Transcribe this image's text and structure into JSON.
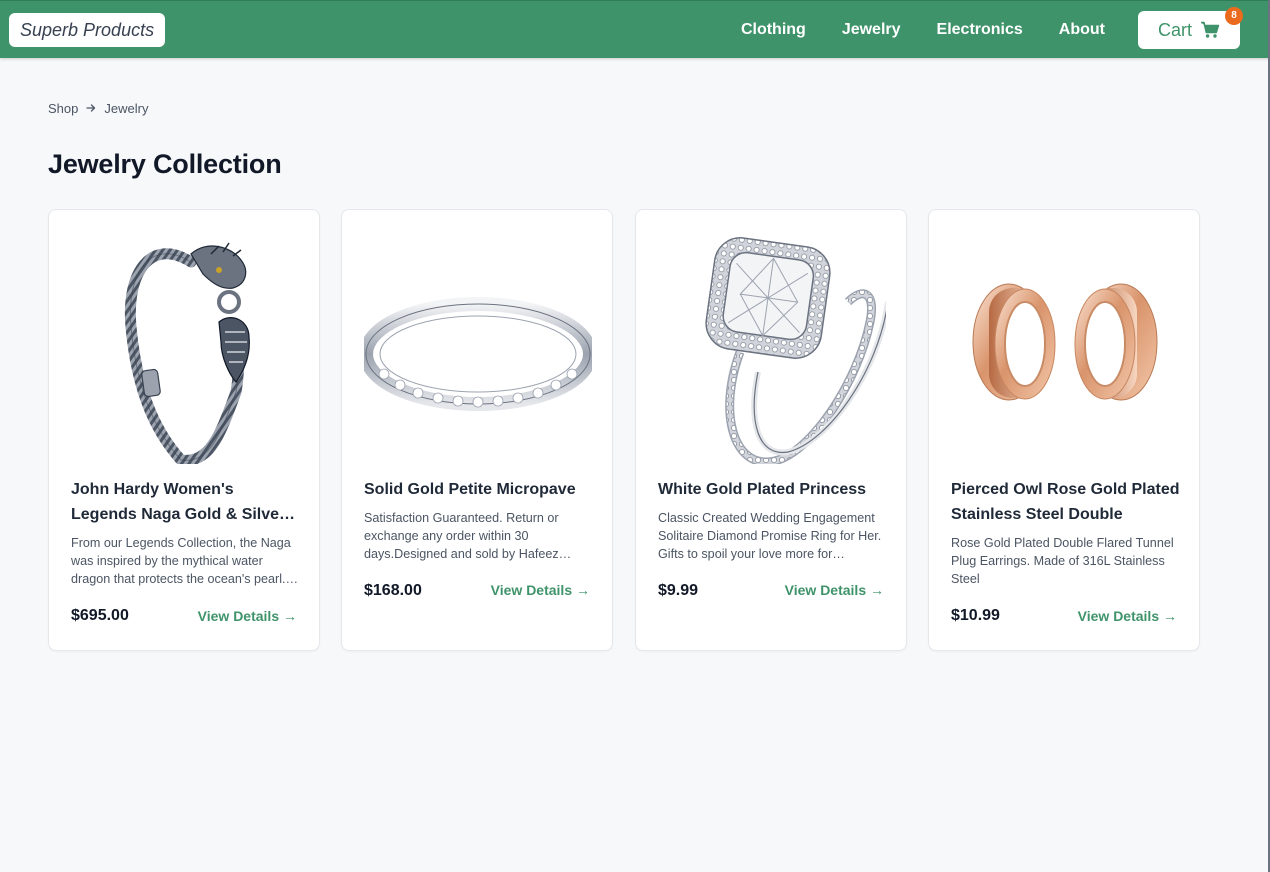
{
  "navbar": {
    "brand": "Superb Products",
    "links": [
      "Clothing",
      "Jewelry",
      "Electronics",
      "About"
    ],
    "cart_label": "Cart",
    "cart_count": "8",
    "cart_icon": "shopping-cart-icon"
  },
  "breadcrumb": {
    "items": [
      "Shop",
      "Jewelry"
    ],
    "separator_icon": "arrow-right-icon"
  },
  "page": {
    "title": "Jewelry Collection"
  },
  "products": [
    {
      "title": "John Hardy Women's Legends Naga Gold & Silver Dragon Station Chain Bracelet",
      "description": "From our Legends Collection, the Naga was inspired by the mythical water dragon that protects the ocean's pearl. Wear facing inward to be bestowed with love and abundance, or outward for protection.",
      "price": "$695.00",
      "link": "View Details →",
      "image_icon": "dragon-bracelet-image"
    },
    {
      "title": "Solid Gold Petite Micropave",
      "description": "Satisfaction Guaranteed. Return or exchange any order within 30 days.Designed and sold by Hafeez Center in the United States.",
      "price": "$168.00",
      "link": "View Details →",
      "image_icon": "micropave-ring-image"
    },
    {
      "title": "White Gold Plated Princess",
      "description": "Classic Created Wedding Engagement Solitaire Diamond Promise Ring for Her. Gifts to spoil your love more for Engagement, Wedding, Anniversary, Valentine's Day...",
      "price": "$9.99",
      "link": "View Details →",
      "image_icon": "princess-ring-image"
    },
    {
      "title": "Pierced Owl Rose Gold Plated Stainless Steel Double",
      "description": "Rose Gold Plated Double Flared Tunnel Plug Earrings. Made of 316L Stainless Steel",
      "price": "$10.99",
      "link": "View Details →",
      "image_icon": "tunnel-plug-earrings-image"
    }
  ],
  "colors": {
    "brand_green": "#3f936a",
    "badge_orange": "#ea6a1e",
    "background": "#f7f8fa"
  }
}
